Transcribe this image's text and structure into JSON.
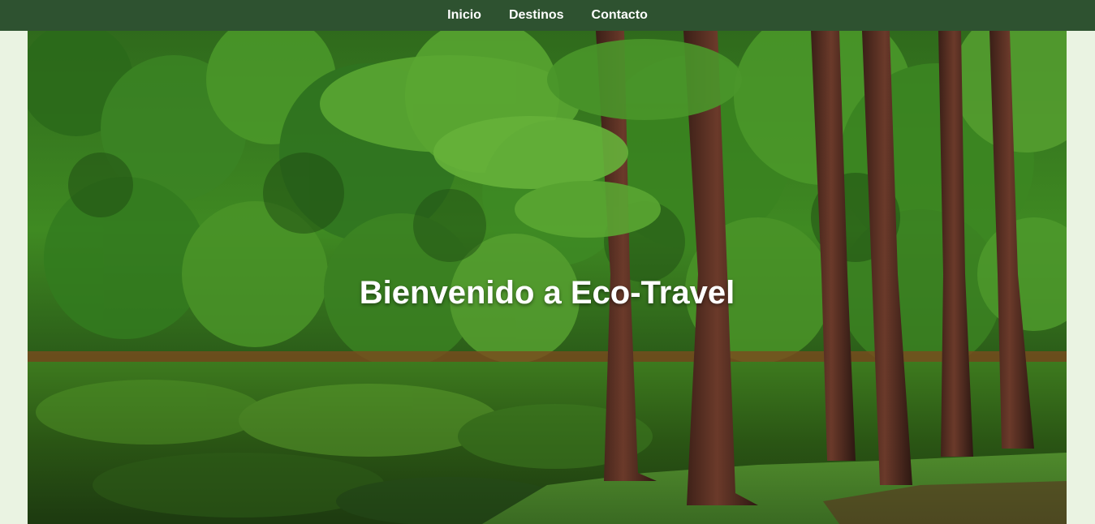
{
  "nav": {
    "items": [
      {
        "label": "Inicio"
      },
      {
        "label": "Destinos"
      },
      {
        "label": "Contacto"
      }
    ]
  },
  "hero": {
    "title": "Bienvenido a Eco-Travel",
    "image": "forest-lake-landscape"
  },
  "colors": {
    "nav_bg": "#2e5230",
    "page_bg": "#eaf3e2",
    "text": "#ffffff"
  }
}
